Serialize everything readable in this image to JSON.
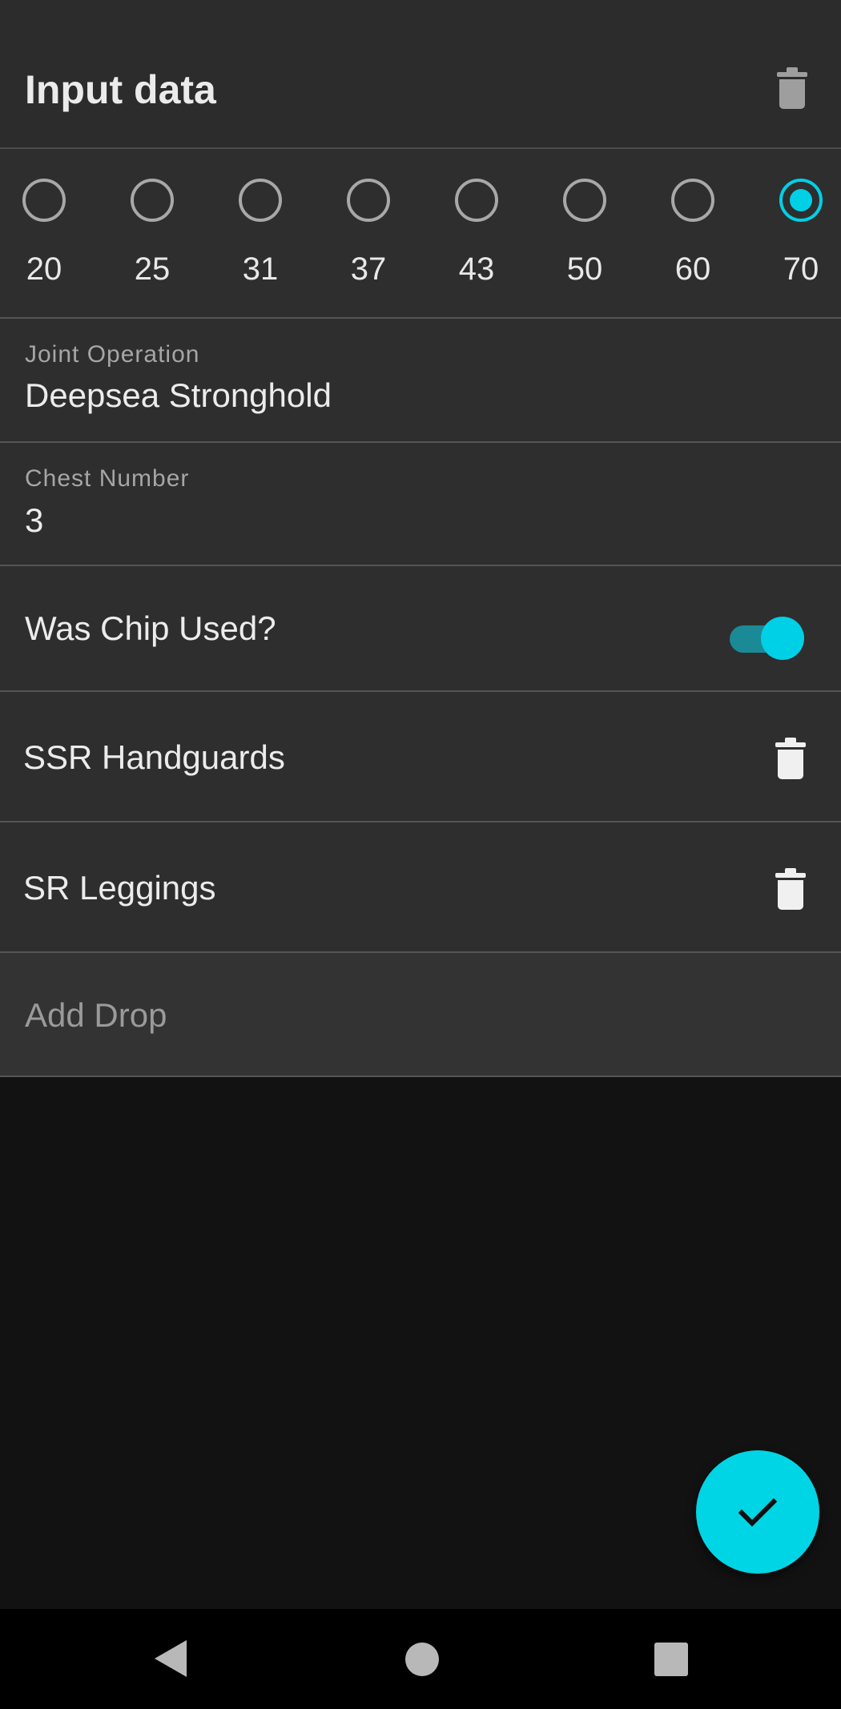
{
  "appbar": {
    "title": "Input data",
    "delete_icon": "trash-icon"
  },
  "radio_group": {
    "options": [
      "20",
      "25",
      "31",
      "37",
      "43",
      "50",
      "60",
      "70"
    ],
    "selected": "70",
    "accent_color": "#00d0e6"
  },
  "joint_operation": {
    "label": "Joint Operation",
    "value": "Deepsea Stronghold"
  },
  "chest_number": {
    "label": "Chest Number",
    "value": "3"
  },
  "chip_used": {
    "label": "Was Chip Used?",
    "checked": true
  },
  "drops": [
    {
      "name": "SSR Handguards",
      "icon": "trash-icon"
    },
    {
      "name": "SR Leggings",
      "icon": "trash-icon"
    }
  ],
  "add_drop": {
    "placeholder": "Add Drop"
  },
  "fab": {
    "icon": "check-icon",
    "color": "#00d5e6"
  },
  "navbar": {
    "icons": [
      "back-icon",
      "home-icon",
      "recents-icon"
    ]
  }
}
